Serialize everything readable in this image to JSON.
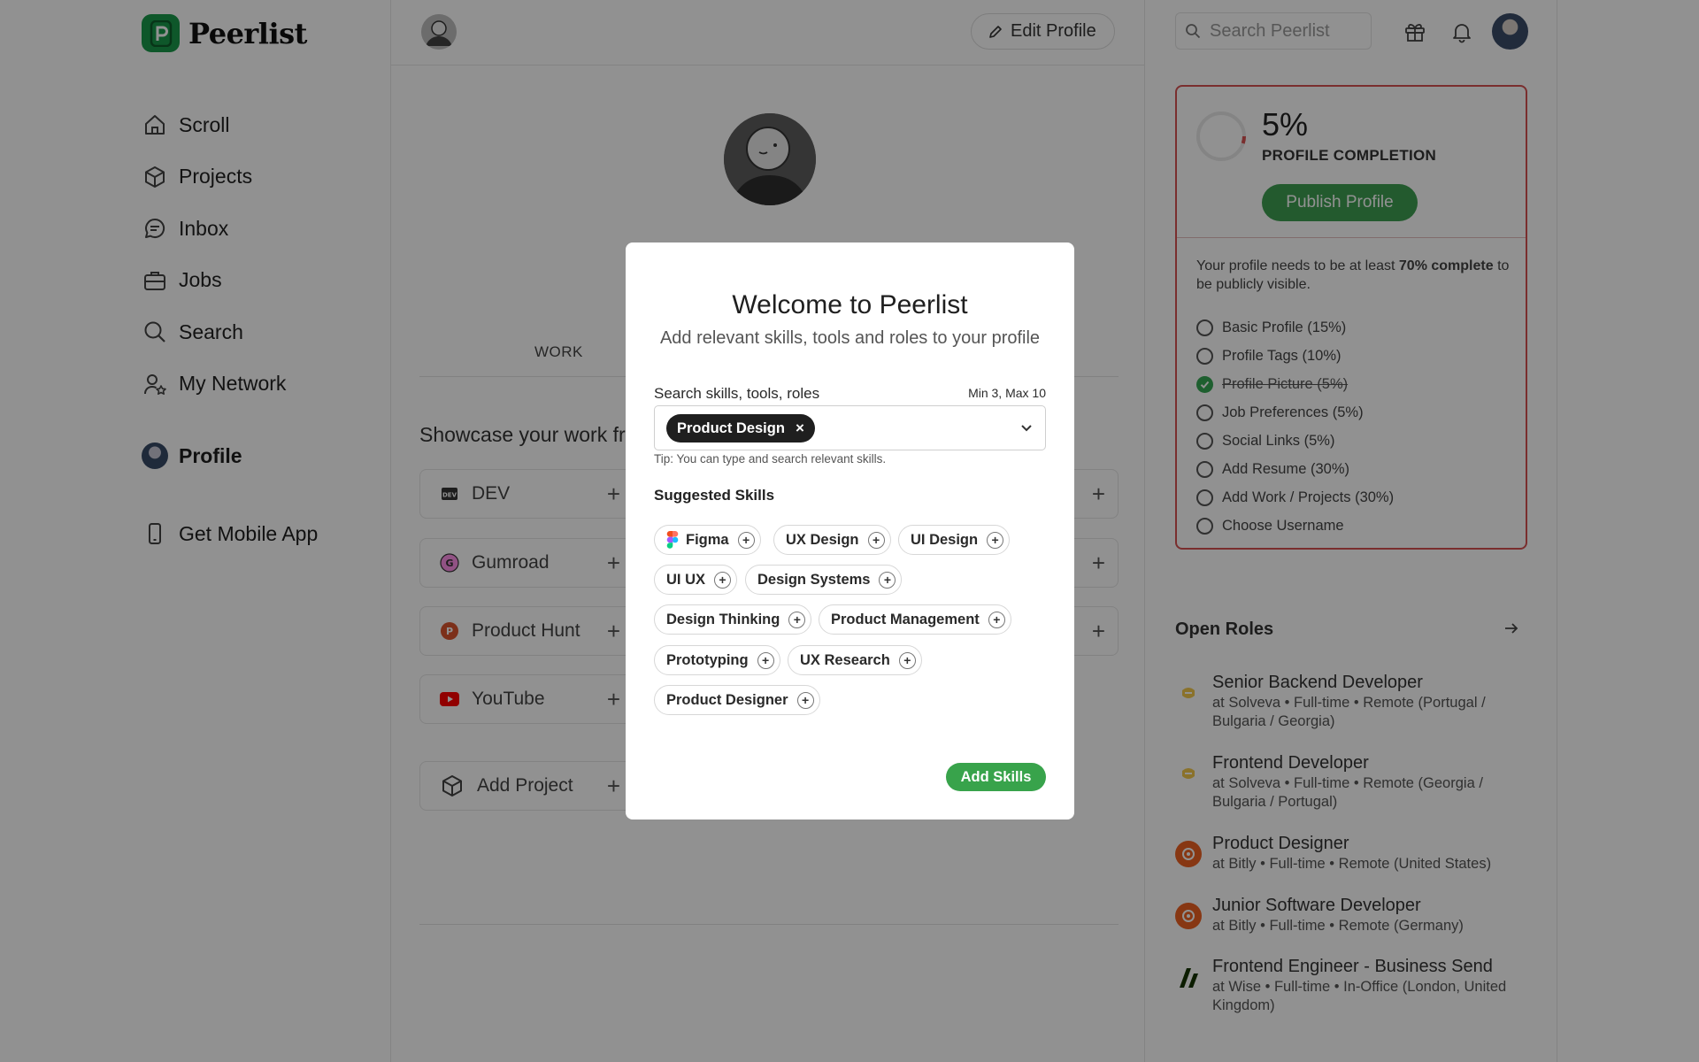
{
  "app": {
    "name": "Peerlist"
  },
  "nav": {
    "items": [
      {
        "label": "Scroll",
        "icon": "home-icon"
      },
      {
        "label": "Projects",
        "icon": "cube-icon"
      },
      {
        "label": "Inbox",
        "icon": "chat-icon"
      },
      {
        "label": "Jobs",
        "icon": "briefcase-icon"
      },
      {
        "label": "Search",
        "icon": "search-icon"
      },
      {
        "label": "My Network",
        "icon": "network-icon"
      }
    ],
    "profile_label": "Profile",
    "mobile_label": "Get Mobile App"
  },
  "header": {
    "edit_profile": "Edit Profile",
    "search_placeholder": "Search Peerlist"
  },
  "main": {
    "tab_work": "WORK",
    "showcase_title": "Showcase your work fr",
    "integrations": [
      "DEV",
      "Gumroad",
      "Product Hunt",
      "YouTube"
    ],
    "add_project": "Add Project"
  },
  "completion": {
    "percent": "5%",
    "label": "PROFILE COMPLETION",
    "publish": "Publish Profile",
    "note_prefix": "Your profile needs to be at least ",
    "note_bold": "70% complete",
    "note_suffix": " to be publicly visible.",
    "items": [
      {
        "label": "Basic Profile (15%)",
        "done": false
      },
      {
        "label": "Profile Tags (10%)",
        "done": false
      },
      {
        "label": "Profile Picture (5%)",
        "done": true
      },
      {
        "label": "Job Preferences (5%)",
        "done": false
      },
      {
        "label": "Social Links (5%)",
        "done": false
      },
      {
        "label": "Add Resume (30%)",
        "done": false
      },
      {
        "label": "Add Work / Projects (30%)",
        "done": false
      },
      {
        "label": "Choose Username",
        "done": false
      }
    ]
  },
  "roles": {
    "title": "Open Roles",
    "items": [
      {
        "title": "Senior Backend Developer",
        "subtitle": "at Solveva • Full-time • Remote (Portugal / Bulgaria / Georgia)"
      },
      {
        "title": "Frontend Developer",
        "subtitle": "at Solveva • Full-time • Remote (Georgia / Bulgaria / Portugal)"
      },
      {
        "title": "Product Designer",
        "subtitle": "at Bitly • Full-time • Remote (United States)"
      },
      {
        "title": "Junior Software Developer",
        "subtitle": "at Bitly • Full-time • Remote (Germany)"
      },
      {
        "title": "Frontend Engineer - Business Send",
        "subtitle": "at Wise • Full-time • In-Office (London, United Kingdom)"
      }
    ]
  },
  "modal": {
    "title": "Welcome to Peerlist",
    "subtitle": "Add relevant skills, tools and roles to your profile",
    "search_label": "Search skills, tools, roles",
    "min_max": "Min 3, Max 10",
    "selected": [
      "Product Design"
    ],
    "tip": "Tip: You can type and search relevant skills.",
    "suggested_title": "Suggested Skills",
    "suggested": [
      "Figma",
      "UX Design",
      "UI Design",
      "UI UX",
      "Design Systems",
      "Design Thinking",
      "Product Management",
      "Prototyping",
      "UX Research",
      "Product Designer"
    ],
    "add_button": "Add Skills"
  },
  "colors": {
    "brand": "#1a9a4a",
    "accent_green": "#38a34b",
    "alert_red": "#d65252"
  }
}
